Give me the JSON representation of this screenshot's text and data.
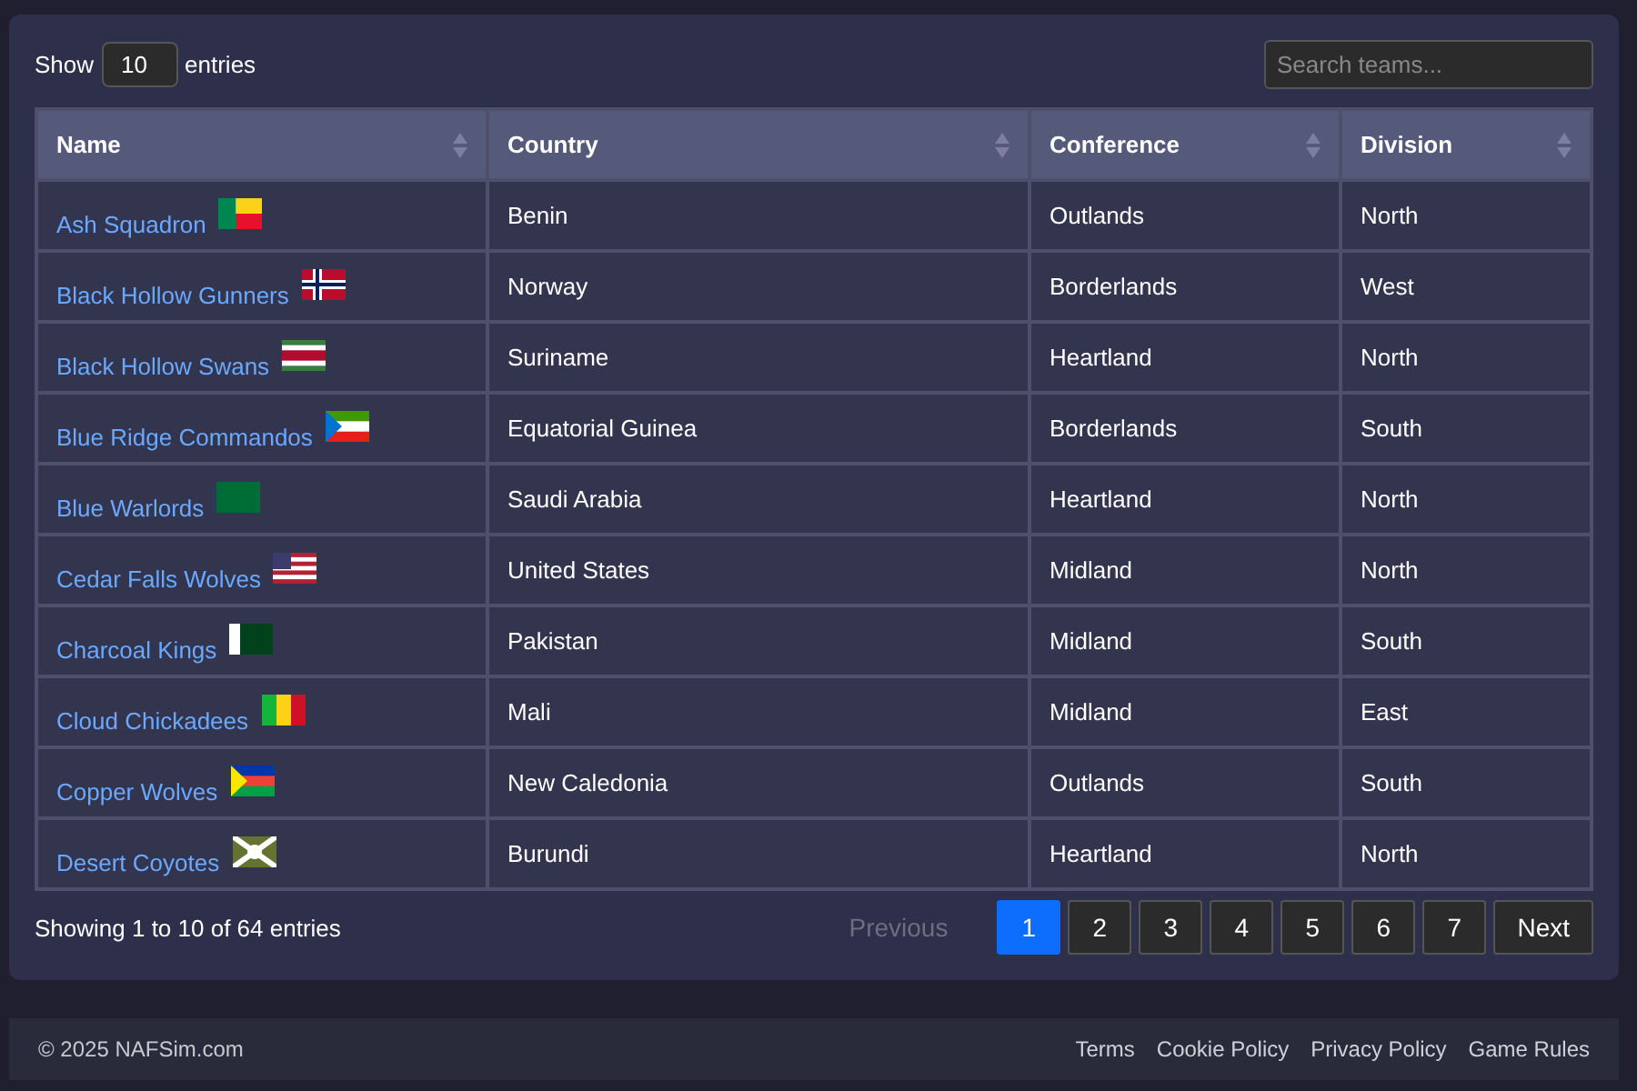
{
  "length_control": {
    "before": "Show",
    "value": "10",
    "after": "entries"
  },
  "search": {
    "placeholder": "Search teams..."
  },
  "table": {
    "columns": [
      "Name",
      "Country",
      "Conference",
      "Division"
    ],
    "rows": [
      {
        "name": "Ash Squadron",
        "country": "Benin",
        "conference": "Outlands",
        "division": "North"
      },
      {
        "name": "Black Hollow Gunners",
        "country": "Norway",
        "conference": "Borderlands",
        "division": "West"
      },
      {
        "name": "Black Hollow Swans",
        "country": "Suriname",
        "conference": "Heartland",
        "division": "North"
      },
      {
        "name": "Blue Ridge Commandos",
        "country": "Equatorial Guinea",
        "conference": "Borderlands",
        "division": "South"
      },
      {
        "name": "Blue Warlords",
        "country": "Saudi Arabia",
        "conference": "Heartland",
        "division": "North"
      },
      {
        "name": "Cedar Falls Wolves",
        "country": "United States",
        "conference": "Midland",
        "division": "North"
      },
      {
        "name": "Charcoal Kings",
        "country": "Pakistan",
        "conference": "Midland",
        "division": "South"
      },
      {
        "name": "Cloud Chickadees",
        "country": "Mali",
        "conference": "Midland",
        "division": "East"
      },
      {
        "name": "Copper Wolves",
        "country": "New Caledonia",
        "conference": "Outlands",
        "division": "South"
      },
      {
        "name": "Desert Coyotes",
        "country": "Burundi",
        "conference": "Heartland",
        "division": "North"
      }
    ]
  },
  "info": "Showing 1 to 10 of 64 entries",
  "pagination": [
    {
      "label": "Previous",
      "kind": "prev",
      "disabled": true,
      "selected": false
    },
    {
      "label": "1",
      "kind": "page",
      "selected": true
    },
    {
      "label": "2",
      "kind": "page",
      "selected": false
    },
    {
      "label": "3",
      "kind": "page",
      "selected": false
    },
    {
      "label": "4",
      "kind": "page",
      "selected": false
    },
    {
      "label": "5",
      "kind": "page",
      "selected": false
    },
    {
      "label": "6",
      "kind": "page",
      "selected": false
    },
    {
      "label": "7",
      "kind": "page",
      "selected": false
    },
    {
      "label": "Next",
      "kind": "next",
      "disabled": false,
      "selected": false
    }
  ],
  "footer": {
    "copyright": "© 2025 NAFSim.com",
    "links": [
      "Terms",
      "Cookie Policy",
      "Privacy Policy",
      "Game Rules"
    ]
  }
}
